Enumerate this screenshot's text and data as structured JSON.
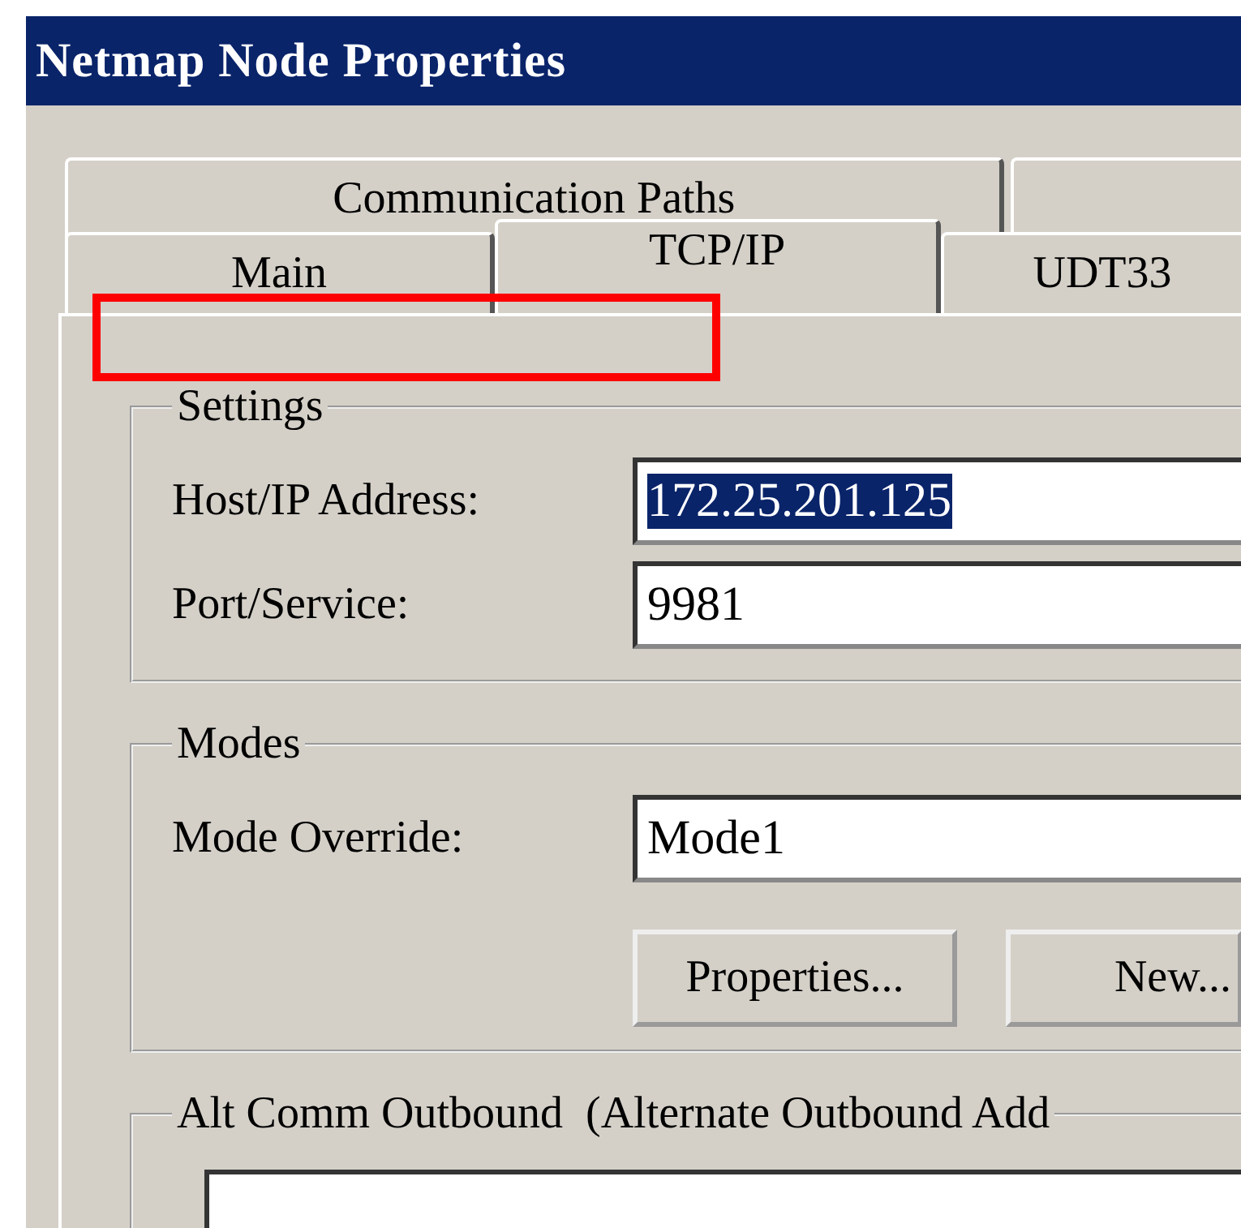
{
  "window": {
    "title": "Netmap Node Properties"
  },
  "tab_rows": [
    {
      "tabs": [
        {
          "label": "Communication Paths",
          "selected": false
        }
      ]
    },
    {
      "tabs": [
        {
          "label": "Main",
          "selected": false
        },
        {
          "label": "TCP/IP",
          "selected": true
        },
        {
          "label": "UDT33",
          "selected": false
        }
      ]
    }
  ],
  "settings": {
    "title": "Settings",
    "fields": [
      {
        "label": "Host/IP Address:",
        "value": "172.25.201.125",
        "text_selected": true
      },
      {
        "label": "Port/Service:",
        "value": "9981",
        "text_selected": false
      }
    ]
  },
  "modes": {
    "title": "Modes",
    "fields": [
      {
        "label": "Mode Override:",
        "value": "Mode1",
        "text_selected": false
      }
    ],
    "buttons": [
      "Properties...",
      "New..."
    ]
  },
  "alt_comm": {
    "title": "Alt Comm Outbound  (Alternate Outbound Add"
  }
}
